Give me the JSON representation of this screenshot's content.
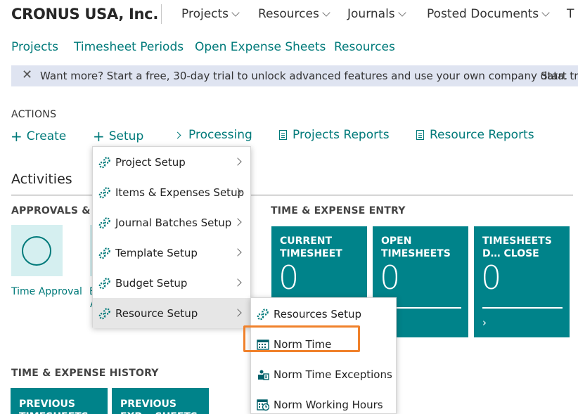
{
  "header": {
    "company": "CRONUS USA, Inc.",
    "nav": [
      "Projects",
      "Resources",
      "Journals",
      "Posted Documents",
      "T"
    ]
  },
  "sublinks": [
    "Projects",
    "Timesheet Periods",
    "Open Expense Sheets",
    "Resources"
  ],
  "banner": {
    "close": "✕",
    "message": "Want more? Start a free, 30-day trial to unlock advanced features and use your own company data.",
    "trial_link": "Start tri"
  },
  "actions": {
    "heading": "ACTIONS",
    "create": "Create",
    "setup": "Setup",
    "processing": "Processing",
    "projects_reports": "Projects Reports",
    "resource_reports": "Resource Reports"
  },
  "activities": {
    "title": "Activities",
    "approvals_heading": "APPROVALS & A",
    "time_approval": "Time Approval",
    "partial_caption_1": "E",
    "partial_caption_2": "A",
    "entry_heading": "TIME & EXPENSE ENTRY",
    "history_heading": "TIME & EXPENSE HISTORY"
  },
  "tiles": [
    {
      "title": "CURRENT TIMESHEET",
      "value": "0"
    },
    {
      "title": "OPEN TIMESHEETS",
      "value": "0"
    },
    {
      "title": "TIMESHEETS D… CLOSE",
      "value": "0",
      "go": "›"
    }
  ],
  "history_tiles": [
    {
      "title": "PREVIOUS TIMESHEETS"
    },
    {
      "title": "PREVIOUS EXP… SHEETS"
    }
  ],
  "setup_menu": {
    "items": [
      {
        "label": "Project Setup",
        "icon": "setup-icon"
      },
      {
        "label": "Items & Expenses Setup",
        "icon": "setup-icon"
      },
      {
        "label": "Journal Batches Setup",
        "icon": "setup-icon"
      },
      {
        "label": "Template Setup",
        "icon": "setup-icon"
      },
      {
        "label": "Budget Setup",
        "icon": "setup-icon"
      },
      {
        "label": "Resource Setup",
        "icon": "setup-icon",
        "active": true
      }
    ]
  },
  "resource_submenu": {
    "items": [
      {
        "label": "Resources Setup",
        "icon": "setup-icon"
      },
      {
        "label": "Norm Time",
        "icon": "calendar-icon",
        "highlighted": true
      },
      {
        "label": "Norm Time Exceptions",
        "icon": "time-exception-icon"
      },
      {
        "label": "Norm Working Hours",
        "icon": "working-hours-icon"
      }
    ]
  },
  "colors": {
    "accent": "#007a7a",
    "tile": "#00838a",
    "highlight": "#f0812b",
    "banner": "#dfe4f1"
  }
}
